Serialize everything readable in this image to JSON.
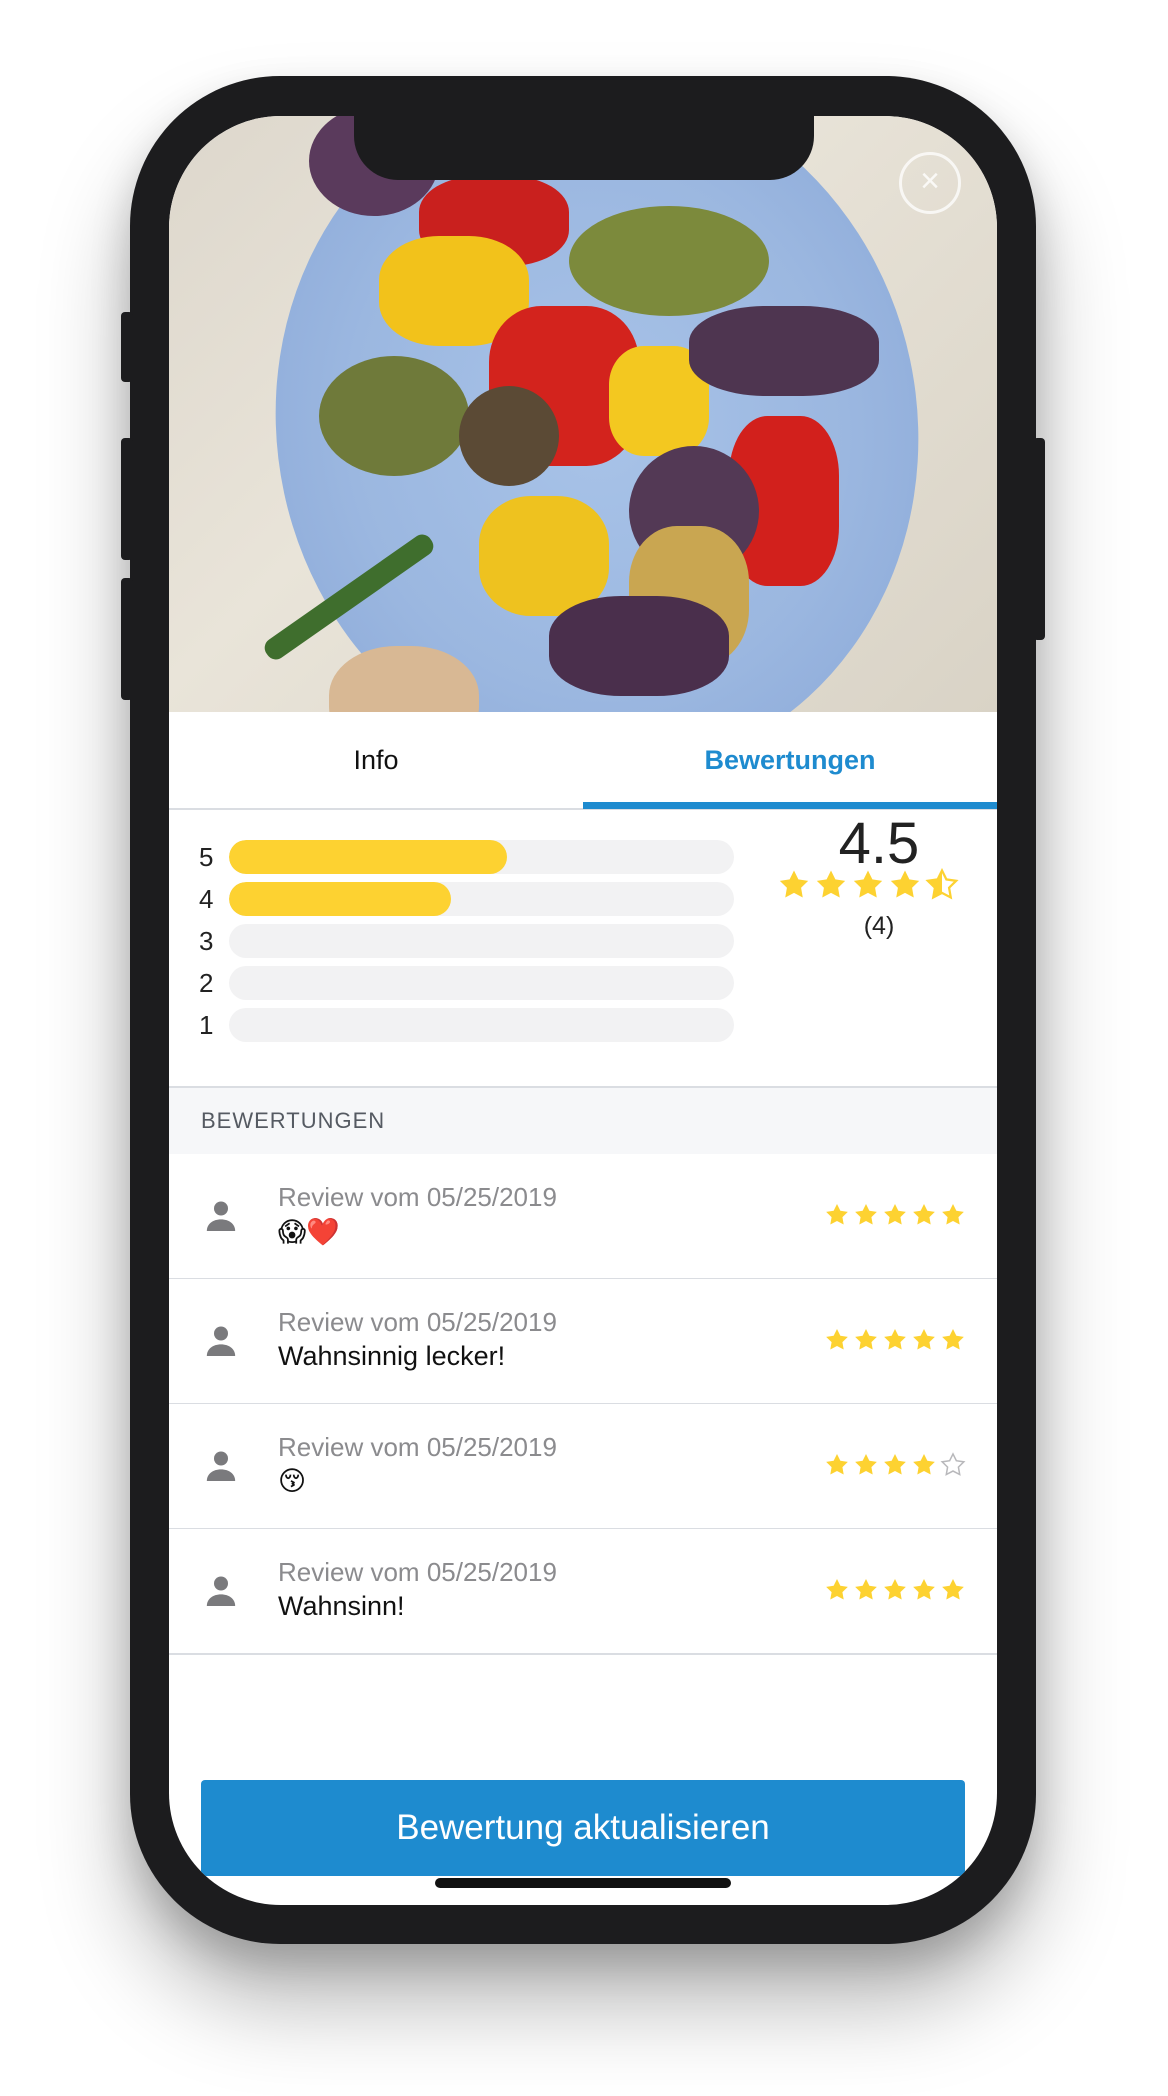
{
  "tabs": [
    {
      "label": "Info",
      "active": false
    },
    {
      "label": "Bewertungen",
      "active": true
    }
  ],
  "summary": {
    "distribution": [
      {
        "stars": "5",
        "fraction": 0.55
      },
      {
        "stars": "4",
        "fraction": 0.44
      },
      {
        "stars": "3",
        "fraction": 0.0
      },
      {
        "stars": "2",
        "fraction": 0.0
      },
      {
        "stars": "1",
        "fraction": 0.0
      }
    ],
    "average": "4.5",
    "average_stars": 4.5,
    "count": "(4)"
  },
  "section_header": "BEWERTUNGEN",
  "reviews": [
    {
      "date": "Review vom 05/25/2019",
      "text": "😱❤️",
      "rating": 5
    },
    {
      "date": "Review vom 05/25/2019",
      "text": "Wahnsinnig lecker!",
      "rating": 5
    },
    {
      "date": "Review vom 05/25/2019",
      "text": "😚",
      "rating": 4
    },
    {
      "date": "Review vom 05/25/2019",
      "text": "Wahnsinn!",
      "rating": 5
    }
  ],
  "update_button": "Bewertung aktualisieren",
  "icons": {
    "close": "close-icon",
    "person": "person-icon",
    "star": "star-icon"
  },
  "colors": {
    "accent": "#1e8bcf",
    "star": "#fdd231",
    "bar_track": "#f2f2f3"
  }
}
